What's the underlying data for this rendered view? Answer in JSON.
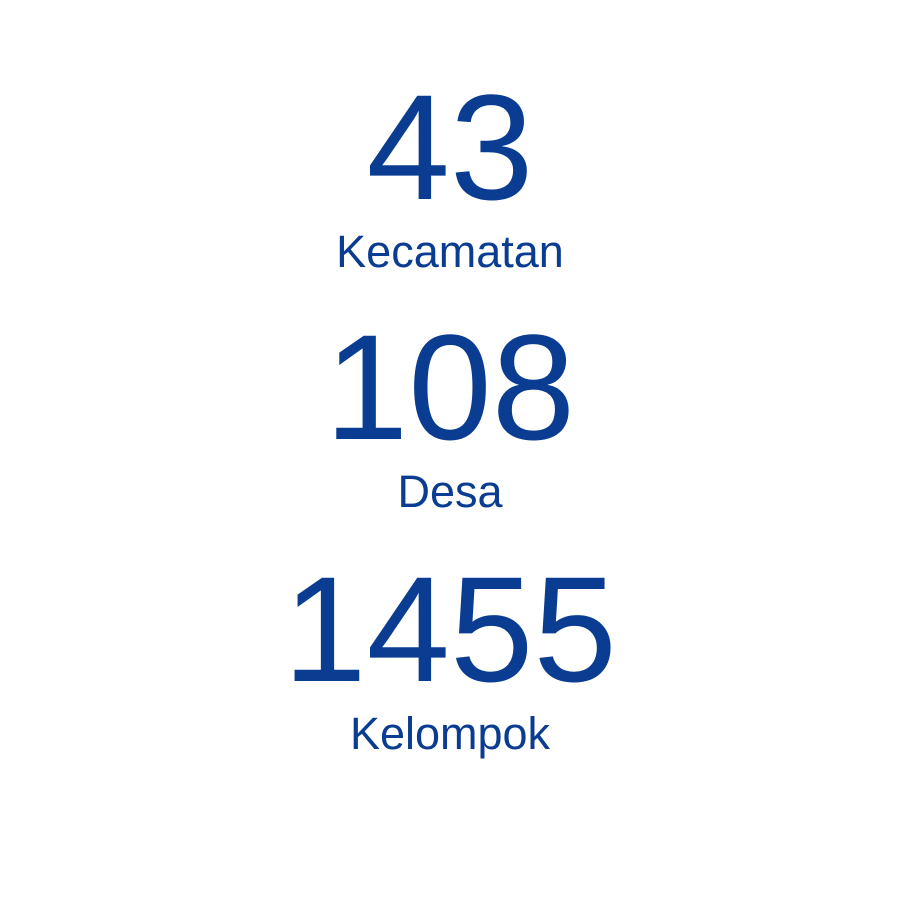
{
  "colors": {
    "text": "#0a3d91",
    "background": "#ffffff"
  },
  "stats": [
    {
      "value": "43",
      "label": "Kecamatan"
    },
    {
      "value": "108",
      "label": "Desa"
    },
    {
      "value": "1455",
      "label": "Kelompok"
    }
  ]
}
